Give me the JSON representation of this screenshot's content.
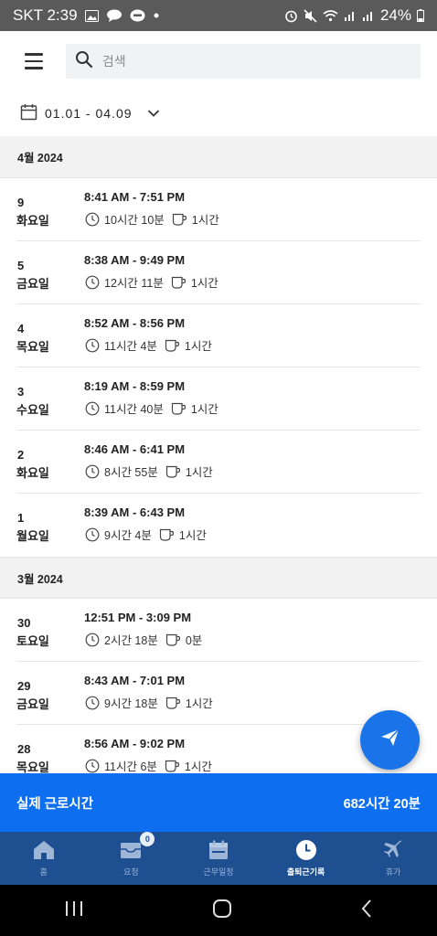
{
  "status_bar": {
    "carrier_time": "SKT 2:39",
    "battery": "24%"
  },
  "search": {
    "placeholder": "검색"
  },
  "date_filter": {
    "range": "01.01 - 04.09"
  },
  "months": [
    {
      "label": "4월 2024",
      "entries": [
        {
          "day": "9",
          "weekday": "화요일",
          "time": "8:41 AM - 7:51 PM",
          "worked": "10시간 10분",
          "break": "1시간"
        },
        {
          "day": "5",
          "weekday": "금요일",
          "time": "8:38 AM - 9:49 PM",
          "worked": "12시간 11분",
          "break": "1시간"
        },
        {
          "day": "4",
          "weekday": "목요일",
          "time": "8:52 AM - 8:56 PM",
          "worked": "11시간 4분",
          "break": "1시간"
        },
        {
          "day": "3",
          "weekday": "수요일",
          "time": "8:19 AM - 8:59 PM",
          "worked": "11시간 40분",
          "break": "1시간"
        },
        {
          "day": "2",
          "weekday": "화요일",
          "time": "8:46 AM - 6:41 PM",
          "worked": "8시간 55분",
          "break": "1시간"
        },
        {
          "day": "1",
          "weekday": "월요일",
          "time": "8:39 AM - 6:43 PM",
          "worked": "9시간 4분",
          "break": "1시간"
        }
      ]
    },
    {
      "label": "3월 2024",
      "entries": [
        {
          "day": "30",
          "weekday": "토요일",
          "time": "12:51 PM - 3:09 PM",
          "worked": "2시간 18분",
          "break": "0분"
        },
        {
          "day": "29",
          "weekday": "금요일",
          "time": "8:43 AM - 7:01 PM",
          "worked": "9시간 18분",
          "break": "1시간"
        },
        {
          "day": "28",
          "weekday": "목요일",
          "time": "8:56 AM - 9:02 PM",
          "worked": "11시간 6분",
          "break": "1시간"
        }
      ]
    }
  ],
  "total": {
    "label": "실제 근로시간",
    "value": "682시간 20분"
  },
  "bottom_nav": {
    "items": [
      {
        "label": "홈",
        "icon": "home-icon"
      },
      {
        "label": "요청",
        "icon": "inbox-icon",
        "badge": "0"
      },
      {
        "label": "근무일정",
        "icon": "calendar-icon"
      },
      {
        "label": "출퇴근기록",
        "icon": "clock-icon",
        "active": true
      },
      {
        "label": "휴가",
        "icon": "airplane-icon"
      }
    ]
  },
  "colors": {
    "primary": "#0d6ff0",
    "nav_bg": "#1d4f91",
    "fab": "#1a73e8"
  }
}
